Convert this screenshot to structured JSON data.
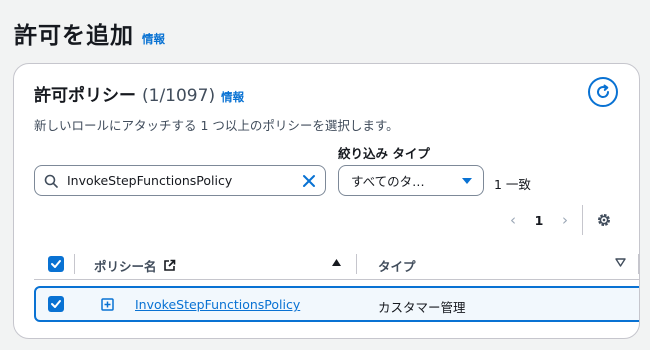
{
  "page": {
    "title": "許可を追加",
    "info_label": "情報"
  },
  "panel": {
    "title": "許可ポリシー",
    "count": "(1/1097)",
    "info_label": "情報",
    "description": "新しいロールにアタッチする 1 つ以上のポリシーを選択します。"
  },
  "filters": {
    "search_value": "InvokeStepFunctionsPolicy",
    "type_label": "絞り込み タイプ",
    "type_selected": "すべてのタ…",
    "match_count": "1 一致"
  },
  "pagination": {
    "current_page": "1"
  },
  "table": {
    "columns": [
      "ポリシー名",
      "タイプ"
    ],
    "rows": [
      {
        "name": "InvokeStepFunctionsPolicy",
        "type": "カスタマー管理",
        "selected": true
      }
    ]
  },
  "colors": {
    "accent": "#0972d3",
    "border": "#c6c6cd",
    "row_selected_bg": "#f2f8fd"
  }
}
